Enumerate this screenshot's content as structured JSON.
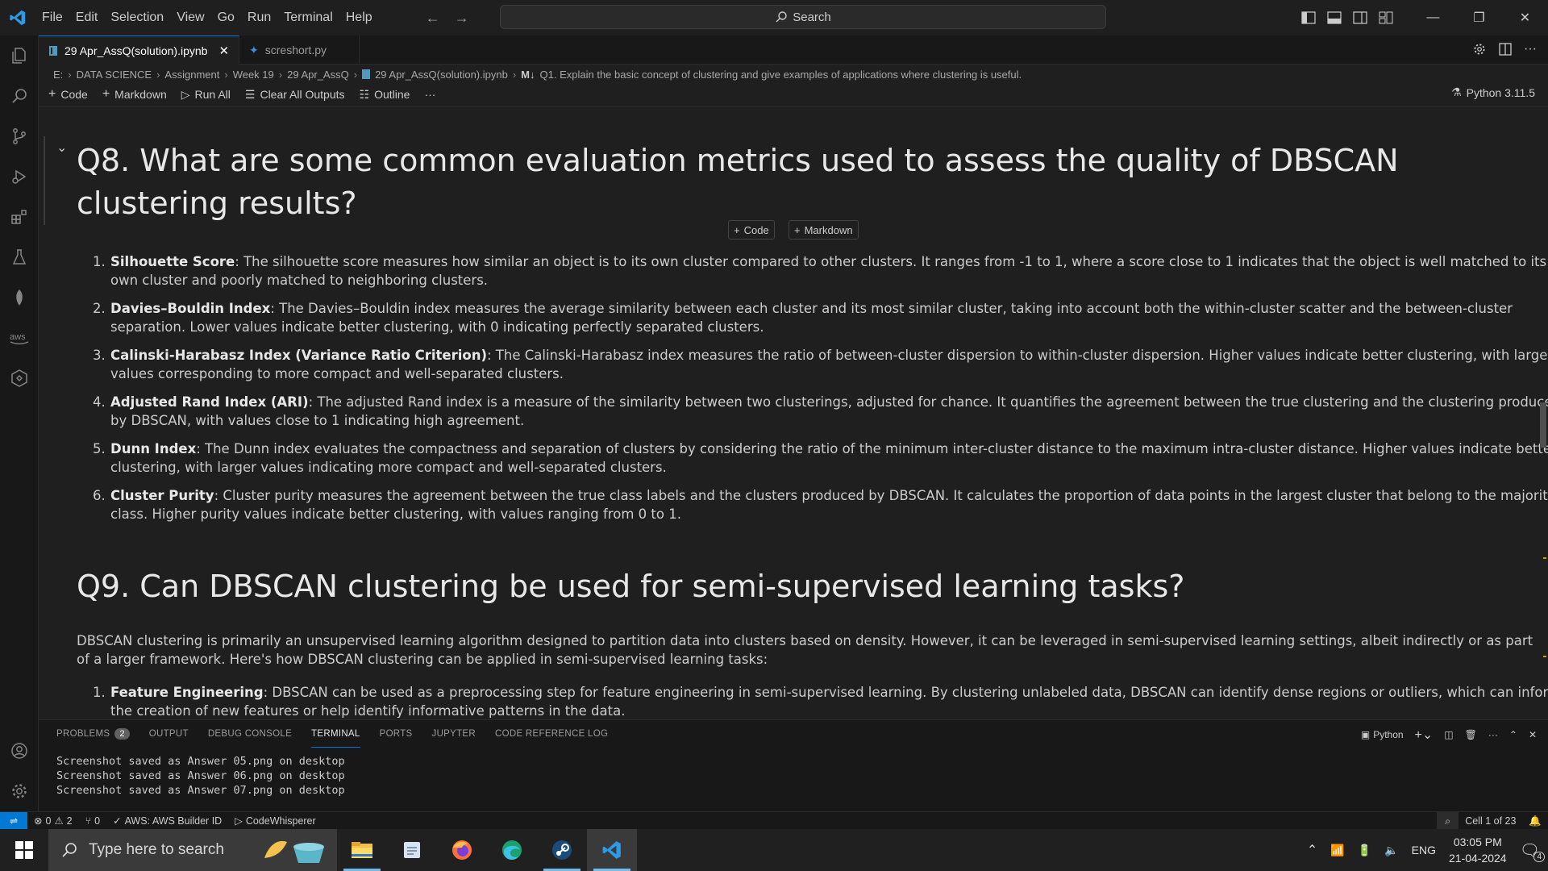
{
  "menu": [
    "File",
    "Edit",
    "Selection",
    "View",
    "Go",
    "Run",
    "Terminal",
    "Help"
  ],
  "search": {
    "label": "Search"
  },
  "tabs": [
    {
      "label": "29 Apr_AssQ(solution).ipynb",
      "active": true
    },
    {
      "label": "screshort.py",
      "active": false
    }
  ],
  "breadcrumb": [
    "E:",
    "DATA SCIENCE",
    "Assignment",
    "Week 19",
    "29 Apr_AssQ",
    "29 Apr_AssQ(solution).ipynb",
    "Q1. Explain the basic concept of clustering and give examples of applications where clustering is useful."
  ],
  "breadcrumb_md_badge": "M↓",
  "toolbar": {
    "code": "Code",
    "markdown": "Markdown",
    "run_all": "Run All",
    "clear_outputs": "Clear All Outputs",
    "outline": "Outline",
    "more": "···",
    "kernel": "Python 3.11.5"
  },
  "notebook": {
    "q8_title": "Q8. What are some common evaluation metrics used to assess the quality of DBSCAN clustering results?",
    "add_code": "Code",
    "add_markdown": "Markdown",
    "q8_items": [
      {
        "num": "1.",
        "term": "Silhouette Score",
        "text": ": The silhouette score measures how similar an object is to its own cluster compared to other clusters. It ranges from -1 to 1, where a score close to 1 indicates that the object is well matched to its own cluster and poorly matched to neighboring clusters."
      },
      {
        "num": "2.",
        "term": "Davies–Bouldin Index",
        "text": ": The Davies–Bouldin index measures the average similarity between each cluster and its most similar cluster, taking into account both the within-cluster scatter and the between-cluster separation. Lower values indicate better clustering, with 0 indicating perfectly separated clusters."
      },
      {
        "num": "3.",
        "term": "Calinski-Harabasz Index (Variance Ratio Criterion)",
        "text": ": The Calinski-Harabasz index measures the ratio of between-cluster dispersion to within-cluster dispersion. Higher values indicate better clustering, with larger values corresponding to more compact and well-separated clusters."
      },
      {
        "num": "4.",
        "term": "Adjusted Rand Index (ARI)",
        "text": ": The adjusted Rand index is a measure of the similarity between two clusterings, adjusted for chance. It quantifies the agreement between the true clustering and the clustering produced by DBSCAN, with values close to 1 indicating high agreement."
      },
      {
        "num": "5.",
        "term": "Dunn Index",
        "text": ": The Dunn index evaluates the compactness and separation of clusters by considering the ratio of the minimum inter-cluster distance to the maximum intra-cluster distance. Higher values indicate better clustering, with larger values indicating more compact and well-separated clusters."
      },
      {
        "num": "6.",
        "term": "Cluster Purity",
        "text": ": Cluster purity measures the agreement between the true class labels and the clusters produced by DBSCAN. It calculates the proportion of data points in the largest cluster that belong to the majority class. Higher purity values indicate better clustering, with values ranging from 0 to 1."
      }
    ],
    "q9_title": "Q9. Can DBSCAN clustering be used for semi-supervised learning tasks?",
    "q9_intro": "DBSCAN clustering is primarily an unsupervised learning algorithm designed to partition data into clusters based on density. However, it can be leveraged in semi-supervised learning settings, albeit indirectly or as part of a larger framework. Here's how DBSCAN clustering can be applied in semi-supervised learning tasks:",
    "q9_items": [
      {
        "num": "1.",
        "term": "Feature Engineering",
        "text": ": DBSCAN can be used as a preprocessing step for feature engineering in semi-supervised learning. By clustering unlabeled data, DBSCAN can identify dense regions or outliers, which can inform the creation of new features or help identify informative patterns in the data."
      }
    ]
  },
  "panel": {
    "tabs": [
      "PROBLEMS",
      "OUTPUT",
      "DEBUG CONSOLE",
      "TERMINAL",
      "PORTS",
      "JUPYTER",
      "CODE REFERENCE LOG"
    ],
    "problems_count": "2",
    "active_tab": "TERMINAL",
    "shell": "Python",
    "terminal_lines": [
      "Screenshot saved as Answer 05.png on desktop",
      "Screenshot saved as Answer 06.png on desktop",
      "Screenshot saved as Answer 07.png on desktop"
    ]
  },
  "status": {
    "errors": "0",
    "warnings": "2",
    "ports": "0",
    "aws": "AWS: AWS Builder ID",
    "codewhisperer": "CodeWhisperer",
    "cell": "Cell 1 of 23"
  },
  "taskbar": {
    "search_placeholder": "Type here to search",
    "lang": "ENG",
    "time": "03:05 PM",
    "date": "21-04-2024",
    "notifications": "4"
  },
  "colors": {
    "accent": "#0078d4",
    "background": "#1f1f1f",
    "sidebar": "#181818"
  }
}
